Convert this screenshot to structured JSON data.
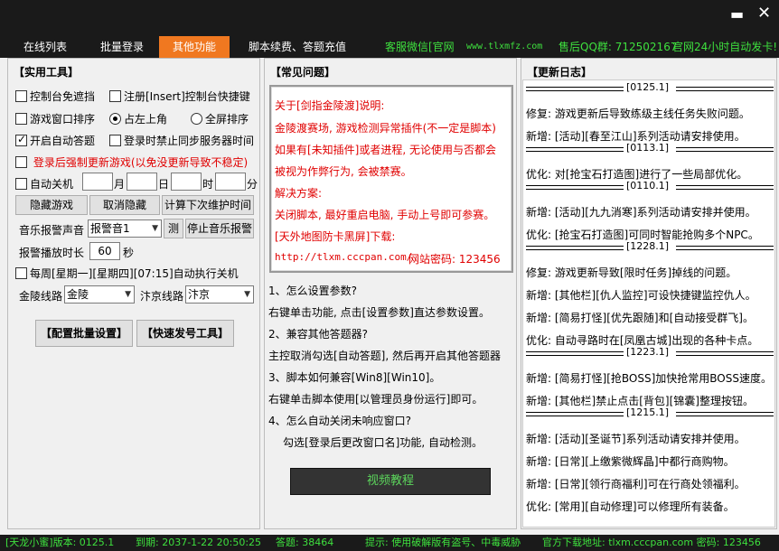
{
  "window": {
    "minimize_icon": "minimize-icon",
    "close_icon": "close-icon"
  },
  "tabs": [
    {
      "label": "在线列表",
      "active": false
    },
    {
      "label": "批量登录",
      "active": false
    },
    {
      "label": "其他功能",
      "active": true
    },
    {
      "label": "脚本续费、答题充值",
      "active": false
    }
  ],
  "promo": {
    "service": "客服微信[官网",
    "site": "www.tlxmfz.com",
    "qq": "售后QQ群: 712502167",
    "slogan": "官网24小时自动发卡!"
  },
  "tools": {
    "title": "【实用工具】",
    "cb_console_nocover": "控制台免遮挡",
    "cb_register_insert": "注册[Insert]控制台快捷键",
    "cb_window_sort": "游戏窗口排序",
    "radio_top_left": "占左上角",
    "radio_fullscreen": "全屏排序",
    "cb_auto_answer": "开启自动答题",
    "cb_block_sync": "登录时禁止同步服务器时间",
    "cb_force_update": "登录后强制更新游戏(以免没更新导致不稳定)",
    "cb_auto_shutdown": "自动关机",
    "unit_month": "月",
    "unit_day": "日",
    "unit_hour": "时",
    "unit_minute": "分",
    "month_value": "",
    "day_value": "",
    "hour_value": "",
    "minute_value": "",
    "btn_hide_game": "隐藏游戏",
    "btn_unhide": "取消隐藏",
    "btn_calc_maintain": "计算下次维护时间",
    "music_label": "音乐报警声音",
    "music_value": "报警音1",
    "btn_test": "测",
    "btn_stop_music": "停止音乐报警",
    "duration_label": "报警播放时长",
    "duration_value": "60",
    "duration_unit": "秒",
    "cb_weekly_shutdown": "每周[星期一][星期四][07:15]自动执行关机",
    "jinling_label": "金陵线路",
    "jinling_value": "金陵",
    "bianjing_label": "汴京线路",
    "bianjing_value": "汴京",
    "btn_batch_settings": "【配置批量设置】",
    "btn_quick_tool": "【快速发号工具】"
  },
  "faq": {
    "title": "【常见问题】",
    "notice_lines": [
      "关于[剑指金陵渡]说明:",
      "金陵渡赛场, 游戏检测异常插件(不一定是脚本)",
      "如果有[未知插件]或者进程, 无论使用与否都会",
      "被视为作弊行为, 会被禁赛。",
      "解决方案:",
      "关闭脚本, 最好重启电脑, 手动上号即可参赛。",
      "[天外地图防卡黑屏]下载:"
    ],
    "notice_link": "http://tlxm.cccpan.com/",
    "notice_pwd": "网站密码: 123456",
    "qa": [
      "1、怎么设置参数?",
      "右键单击功能, 点击[设置参数]直达参数设置。",
      "2、兼容其他答题器?",
      "主控取消勾选[自动答题], 然后再开启其他答题器",
      "3、脚本如何兼容[Win8][Win10]。",
      "右键单击脚本使用[以管理员身份运行]即可。",
      "4、怎么自动关闭未响应窗口?",
      "勾选[登录后更改窗口名]功能, 自动检测。"
    ],
    "video_button": "视频教程"
  },
  "changelog": {
    "title": "【更新日志】",
    "entries": [
      {
        "kind": "sep",
        "text": "[0125.1]"
      },
      {
        "kind": "line",
        "text": "修复: 游戏更新后导致练级主线任务失败问题。"
      },
      {
        "kind": "line",
        "text": "新增: [活动][春至江山]系列活动请安排使用。"
      },
      {
        "kind": "sep",
        "text": "[0113.1]"
      },
      {
        "kind": "line",
        "text": "优化: 对[抢宝石打造图]进行了一些局部优化。"
      },
      {
        "kind": "sep",
        "text": "[0110.1]"
      },
      {
        "kind": "line",
        "text": "新增: [活动][九九消寒]系列活动请安排并使用。"
      },
      {
        "kind": "line",
        "text": "优化: [抢宝石打造图]可同时智能抢购多个NPC。"
      },
      {
        "kind": "sep",
        "text": "[1228.1]"
      },
      {
        "kind": "line",
        "text": "修复: 游戏更新导致[限时任务]掉线的问题。"
      },
      {
        "kind": "line",
        "text": "新增: [其他栏][仇人监控]可设快捷键监控仇人。"
      },
      {
        "kind": "line",
        "text": "新增: [简易打怪][优先跟随]和[自动接受群飞]。"
      },
      {
        "kind": "line",
        "text": "优化: 自动寻路时在[凤凰古城]出现的各种卡点。"
      },
      {
        "kind": "sep",
        "text": "[1223.1]"
      },
      {
        "kind": "line",
        "text": "新增: [简易打怪][抢BOSS]加快抢常用BOSS速度。"
      },
      {
        "kind": "line",
        "text": "新增: [其他栏]禁止点击[背包][锦囊]整理按钮。"
      },
      {
        "kind": "sep",
        "text": "[1215.1]"
      },
      {
        "kind": "line",
        "text": "新增: [活动][圣诞节]系列活动请安排并使用。"
      },
      {
        "kind": "line",
        "text": "新增: [日常][上缴紫微辉晶]中都行商购物。"
      },
      {
        "kind": "line",
        "text": "新增: [日常][领行商福利]可在行商处领福利。"
      },
      {
        "kind": "line",
        "text": "优化: [常用][自动修理]可以修理所有装备。"
      }
    ]
  },
  "status": {
    "version": "[天龙小蜜]版本: 0125.1",
    "expiry": "到期: 2037-1-22 20:50:25",
    "answers": "答题: 38464",
    "tip": "提示: 使用破解版有盗号、中毒威胁",
    "download": "官方下载地址: tlxm.cccpan.com 密码: 123456"
  }
}
